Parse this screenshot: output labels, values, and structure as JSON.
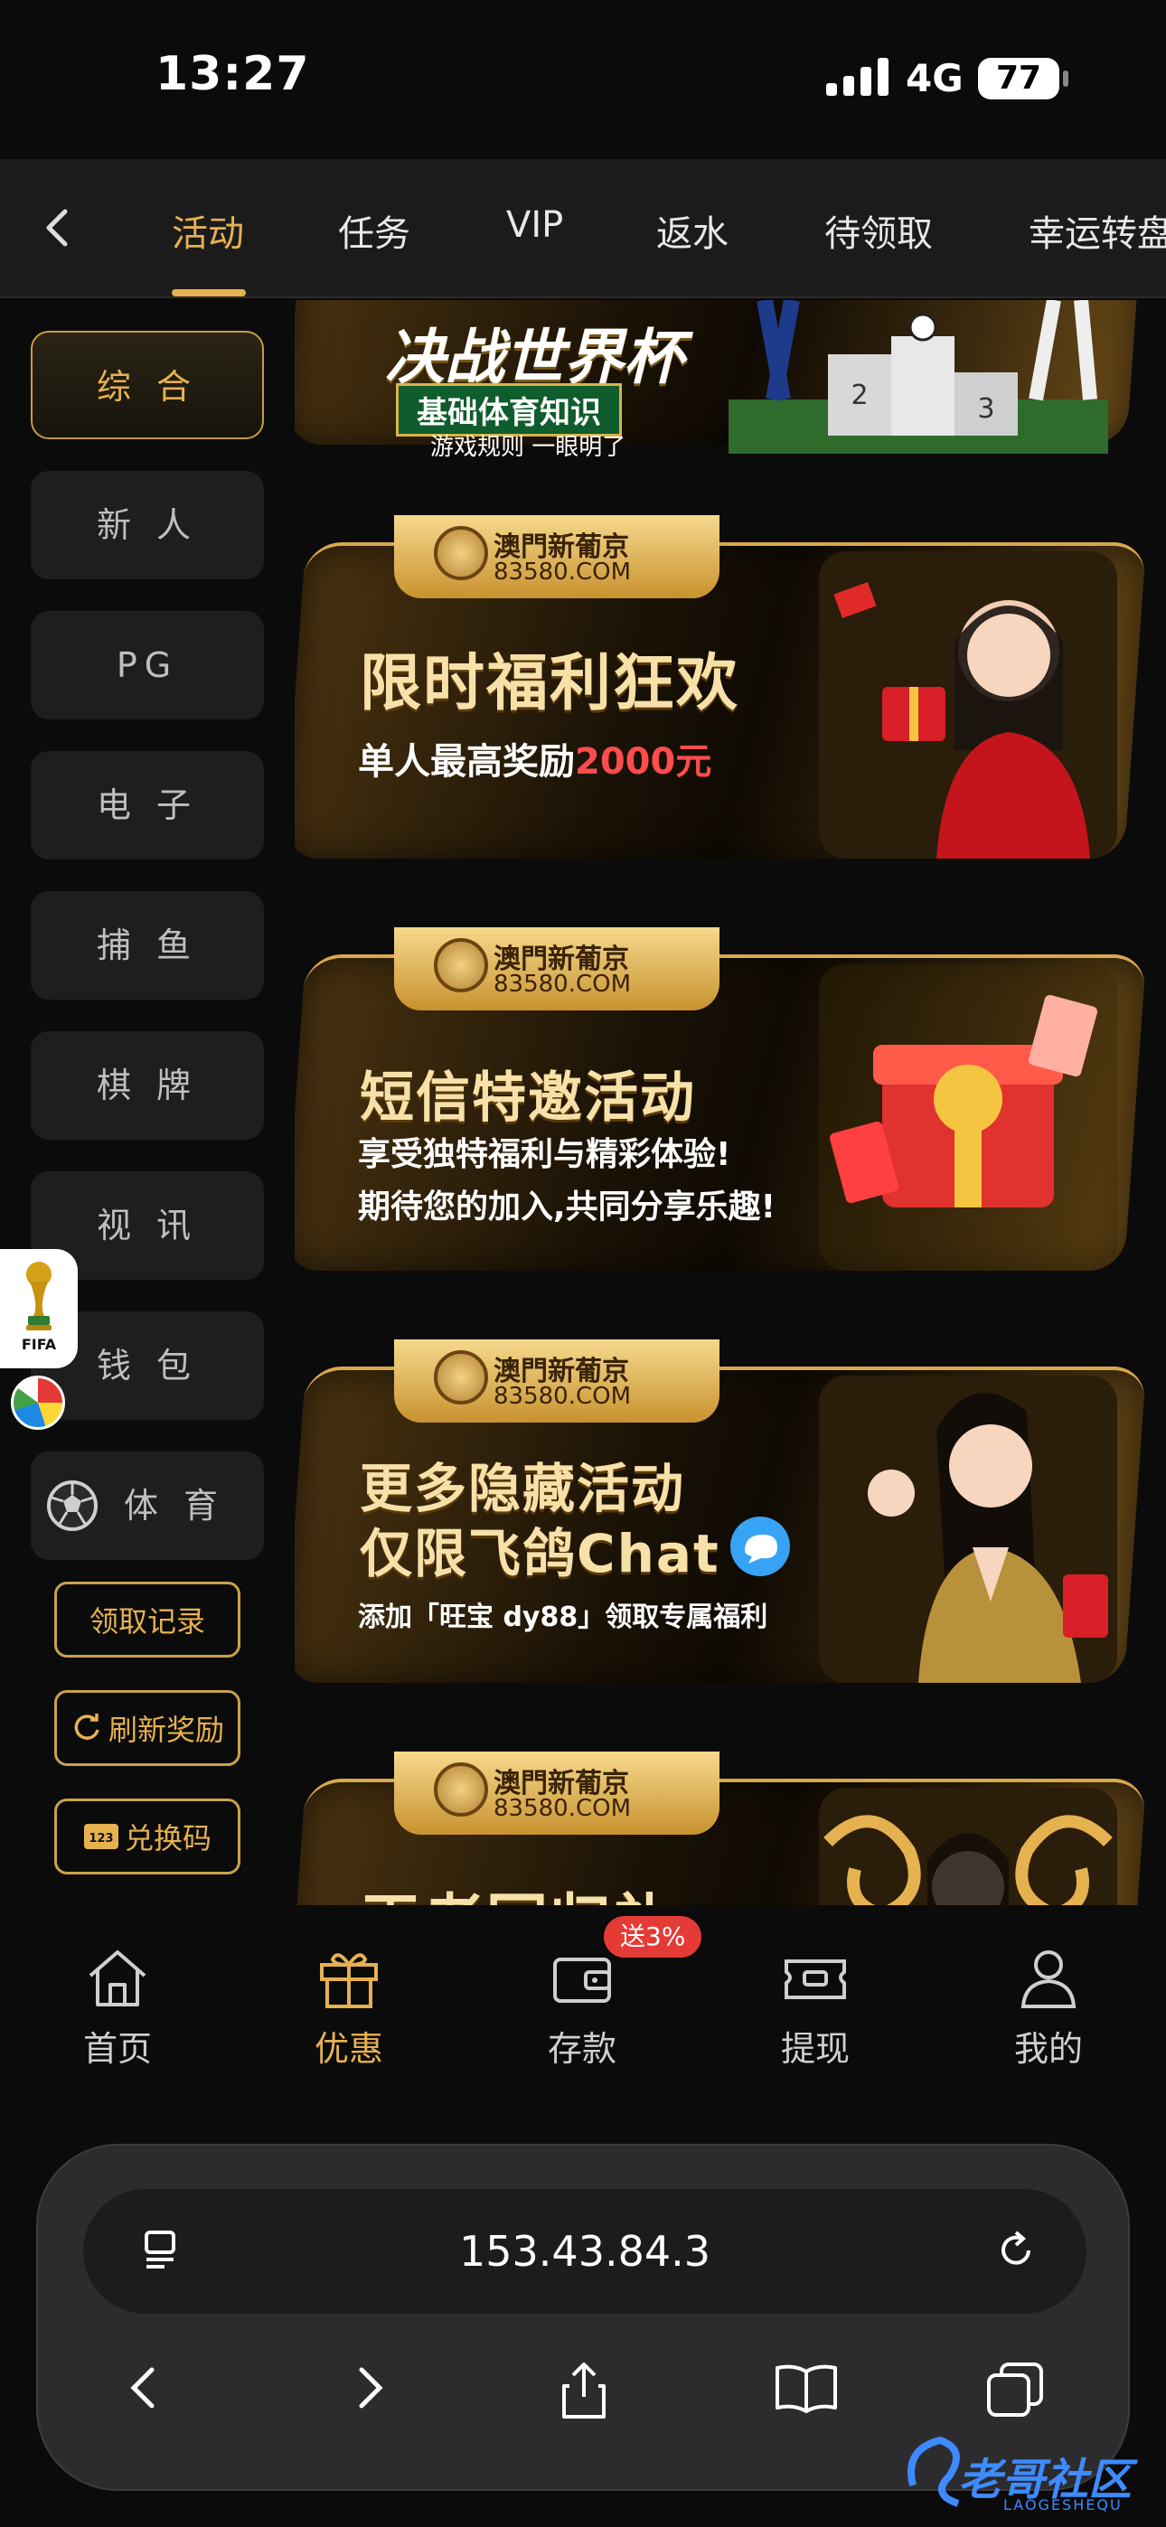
{
  "status_bar": {
    "time": "13:27",
    "network": "4G",
    "battery": "77"
  },
  "top_tabs": [
    {
      "label": "活动",
      "active": true
    },
    {
      "label": "任务"
    },
    {
      "label": "VIP"
    },
    {
      "label": "返水"
    },
    {
      "label": "待领取"
    },
    {
      "label": "幸运转盘"
    }
  ],
  "side_nav": {
    "items": [
      "综 合",
      "新 人",
      "PG",
      "电 子",
      "捕 鱼",
      "棋 牌",
      "视 讯",
      "钱 包",
      "体 育"
    ],
    "active": "综 合",
    "actions": [
      "领取记录",
      "刷新奖励",
      "兑换码"
    ]
  },
  "fifa_badge": {
    "label": "FIFA"
  },
  "banners": [
    {
      "headline": "决战世界杯",
      "tagline": "基础体育知识",
      "sub": "游戏规则 一眼明了"
    },
    {
      "brand_cn": "澳門新葡京",
      "brand_en": "83580.COM",
      "headline": "限时福利狂欢",
      "sub_prefix": "单人最高奖励",
      "sub_highlight": "2000元"
    },
    {
      "brand_cn": "澳門新葡京",
      "brand_en": "83580.COM",
      "headline": "短信特邀活动",
      "sub_line1": "享受独特福利与精彩体验!",
      "sub_line2": "期待您的加入,共同分享乐趣!"
    },
    {
      "brand_cn": "澳門新葡京",
      "brand_en": "83580.COM",
      "headline_line1": "更多隐藏活动",
      "headline_line2": "仅限飞鸽Chat",
      "sub": "添加「旺宝 dy88」领取专属福利"
    },
    {
      "brand_cn": "澳門新葡京",
      "brand_en": "83580.COM",
      "headline": "王者回归礼"
    }
  ],
  "bottom_nav": {
    "items": [
      {
        "label": "首页",
        "icon": "home-icon"
      },
      {
        "label": "优惠",
        "icon": "gift-icon",
        "active": true
      },
      {
        "label": "存款",
        "icon": "wallet-icon"
      },
      {
        "label": "提现",
        "icon": "ticket-icon"
      },
      {
        "label": "我的",
        "icon": "user-icon"
      }
    ],
    "deposit_badge": "送3%"
  },
  "browser": {
    "url": "153.43.84.3"
  },
  "watermark": {
    "text": "老哥社区",
    "sub": "LAOGESHEQU"
  },
  "colors": {
    "accent_gold": "#e6b14f",
    "badge_red": "#e53b36",
    "background": "#0b0b0b"
  }
}
